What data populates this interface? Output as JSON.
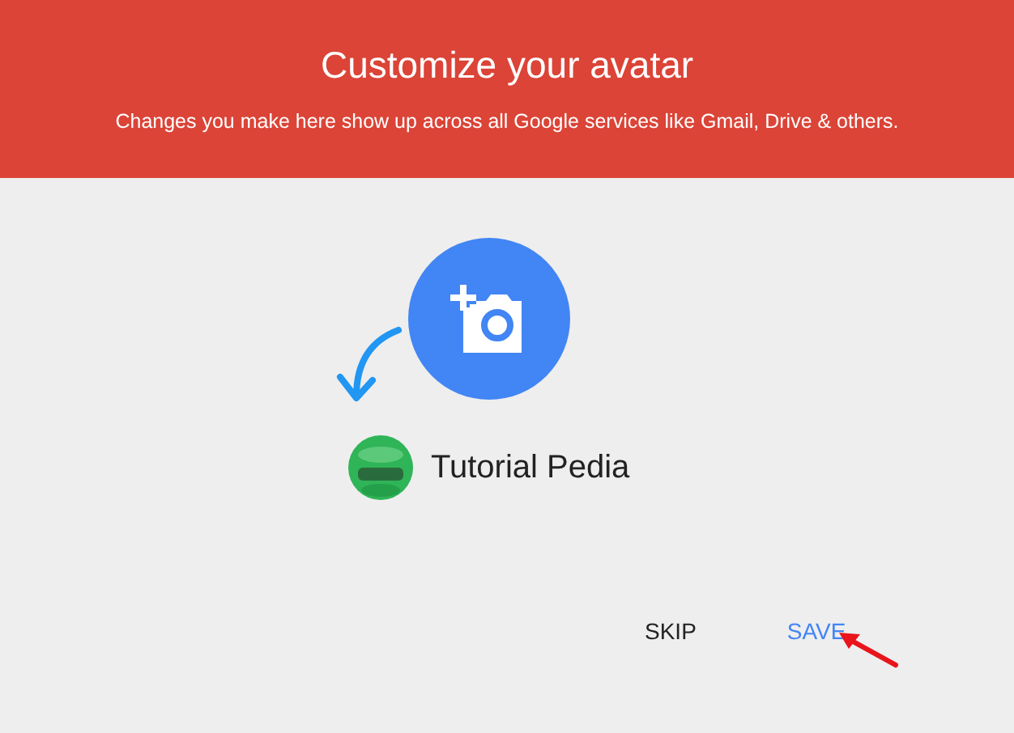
{
  "header": {
    "title": "Customize your avatar",
    "subtitle": "Changes you make here show up across all Google services like Gmail, Drive & others."
  },
  "profile": {
    "name": "Tutorial Pedia"
  },
  "buttons": [
    {
      "label": "SKIP",
      "kind": "plain"
    },
    {
      "label": "SAVE",
      "kind": "primary"
    }
  ]
}
